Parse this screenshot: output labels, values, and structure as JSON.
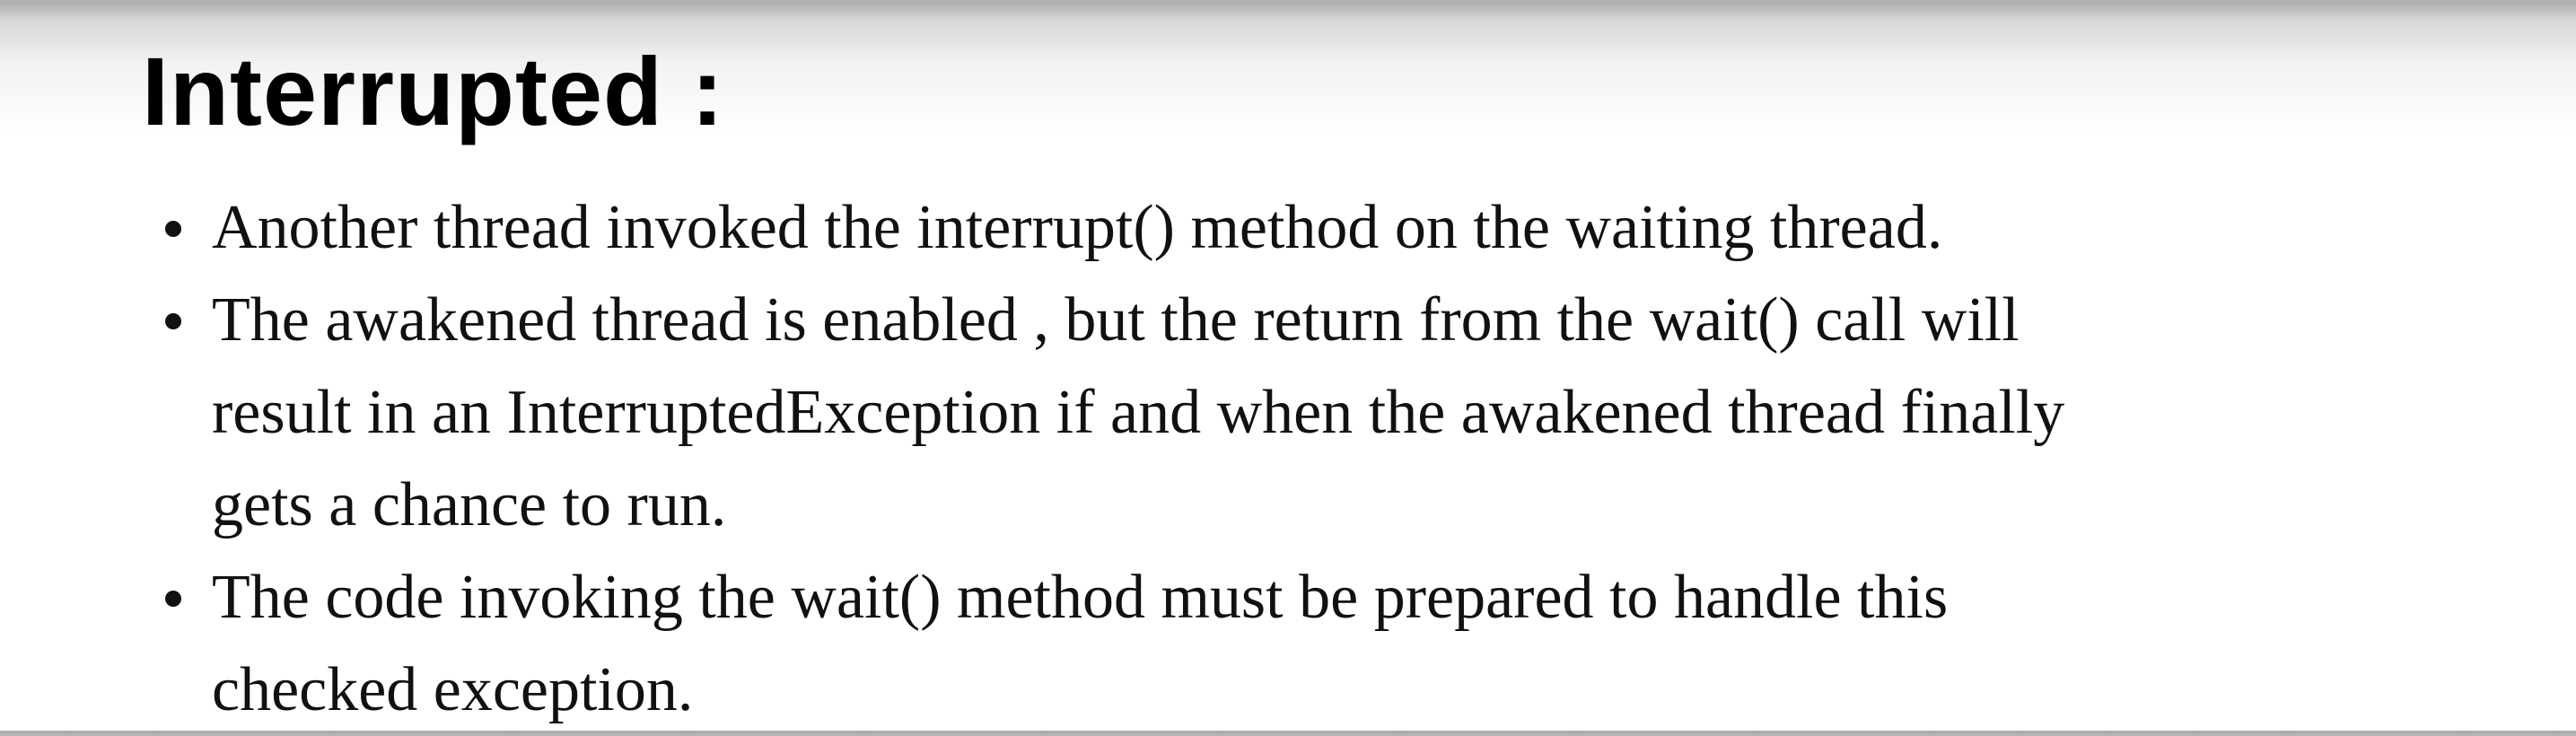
{
  "slide": {
    "title": "Interrupted :",
    "bullets": [
      {
        "lines": [
          "Another thread invoked the interrupt() method on the waiting thread."
        ]
      },
      {
        "lines": [
          "The awakened thread is enabled , but the return from the wait() call will",
          "result in an InterruptedException if and when the awakened thread finally",
          "gets a chance to run."
        ]
      },
      {
        "lines": [
          "The code invoking the wait() method must be prepared to handle this",
          "checked exception."
        ]
      }
    ]
  }
}
